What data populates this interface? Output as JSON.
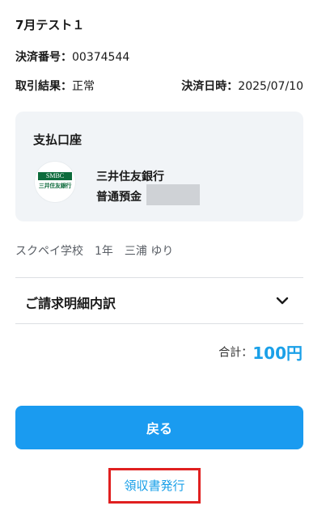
{
  "header": {
    "title": "7月テスト１"
  },
  "details": {
    "payment_number_label": "決済番号：",
    "payment_number": "00374544",
    "result_label": "取引結果：",
    "result_value": "正常",
    "datetime_label": "決済日時：",
    "datetime_value": "2025/07/10"
  },
  "payment_account": {
    "title": "支払口座",
    "logo_top": "SMBC",
    "logo_bottom": "三井住友銀行",
    "bank_name": "三井住友銀行",
    "account_type": "普通預金"
  },
  "student": {
    "text": "スクペイ学校　1年　三浦 ゆり"
  },
  "breakdown": {
    "label": "ご請求明細内訳",
    "icon": "chevron-down-icon"
  },
  "total": {
    "label": "合計：",
    "amount": "100円"
  },
  "actions": {
    "back_label": "戻る",
    "receipt_label": "領収書発行"
  },
  "colors": {
    "accent": "#1a9bf0",
    "amount": "#1aa0e8",
    "highlight_border": "#e02020",
    "bank_green": "#0d6b3c"
  }
}
